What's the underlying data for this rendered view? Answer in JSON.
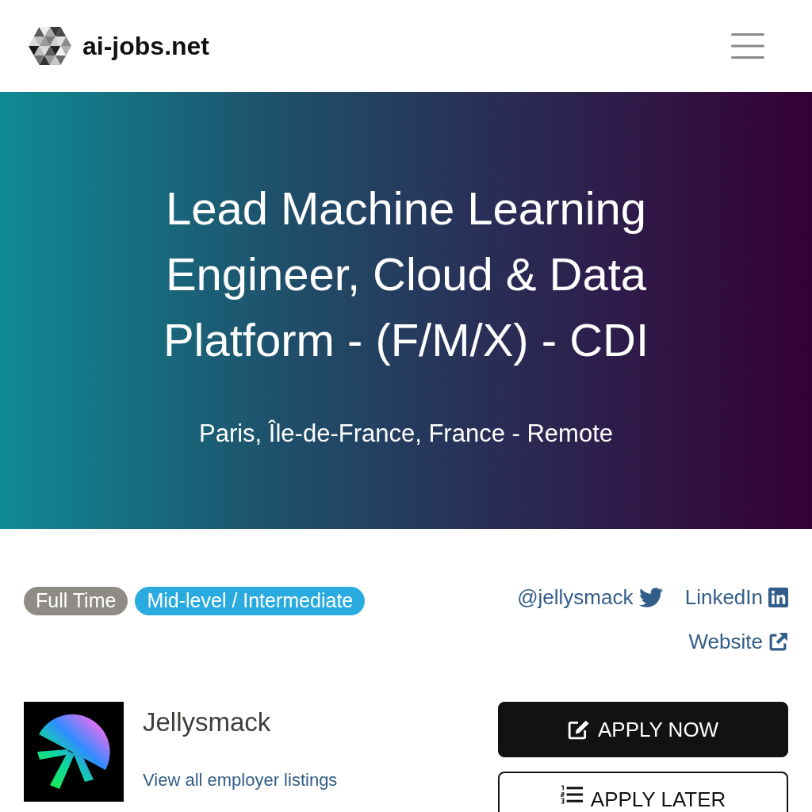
{
  "navbar": {
    "brand": "ai-jobs.net"
  },
  "hero": {
    "title": "Lead Machine Learning Engineer, Cloud & Data Platform - (F/M/X) - CDI",
    "location": "Paris, Île-de-France, France - Remote"
  },
  "tags": [
    {
      "label": "Full Time",
      "color": "#8e8c84"
    },
    {
      "label": "Mid-level / Intermediate",
      "color": "#29abe0"
    }
  ],
  "links": [
    {
      "label": "@jellysmack",
      "kind": "twitter"
    },
    {
      "label": "LinkedIn",
      "kind": "linkedin"
    },
    {
      "label": "Website",
      "kind": "external"
    }
  ],
  "company": {
    "name": "Jellysmack",
    "listings_link": "View all employer listings"
  },
  "actions": [
    {
      "label": "APPLY NOW",
      "kind": "primary"
    },
    {
      "label": "APPLY LATER",
      "kind": "outline"
    }
  ]
}
